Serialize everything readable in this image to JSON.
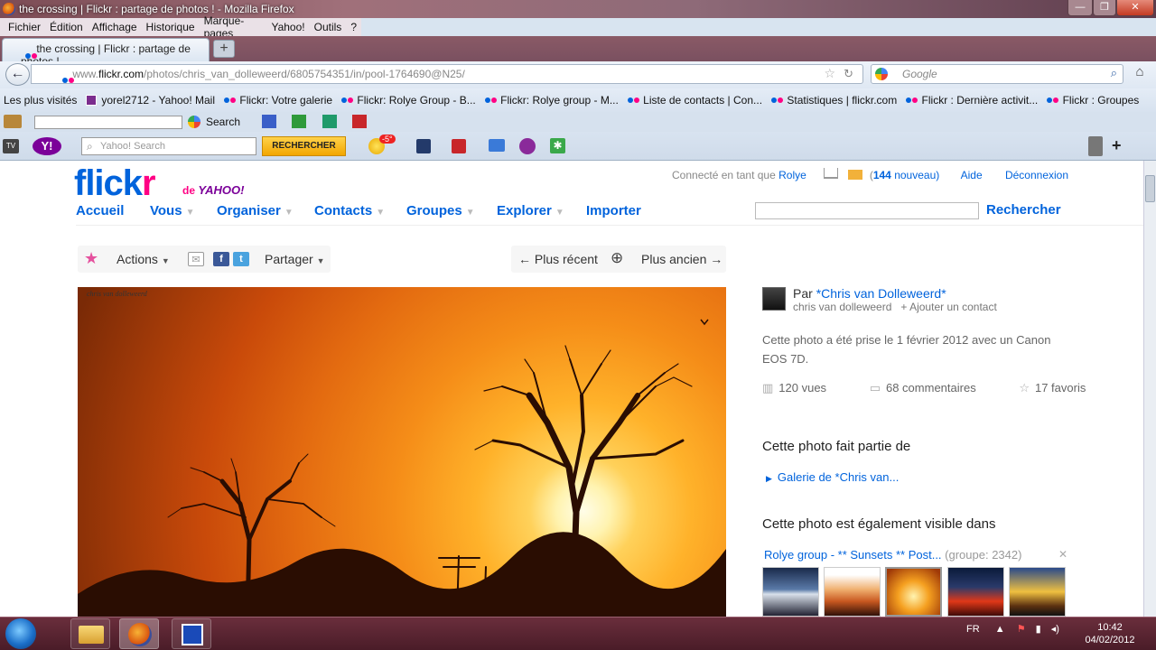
{
  "window": {
    "title": "the crossing | Flickr : partage de photos ! - Mozilla Firefox",
    "controls": [
      "—",
      "❐",
      "✕"
    ]
  },
  "menubar": [
    "Fichier",
    "Édition",
    "Affichage",
    "Historique",
    "Marque-pages",
    "Yahoo!",
    "Outils",
    "?"
  ],
  "tab": {
    "title": "the crossing | Flickr : partage de photos !",
    "new_tab": "+"
  },
  "nav": {
    "url_prefix": "www.",
    "url_domain": "flickr.com",
    "url_path": "/photos/chris_van_dolleweerd/6805754351/in/pool-1764690@N25/",
    "search_placeholder": "Google"
  },
  "bookmarks": [
    "Les plus visités",
    "yorel2712 - Yahoo! Mail",
    "Flickr: Votre galerie",
    "Flickr: Rolye Group - B...",
    "Flickr: Rolye group - M...",
    "Liste de contacts | Con...",
    "Statistiques | flickr.com",
    "Flickr : Dernière activit...",
    "Flickr : Groupes"
  ],
  "toolbar1": {
    "search_label": "Search"
  },
  "yahoo_toolbar": {
    "search_placeholder": "Yahoo! Search",
    "search_button": "RECHERCHER",
    "temp_badge": "-5°"
  },
  "flickr": {
    "logo_main": "flick",
    "logo_r": "r",
    "logo_de": "de",
    "logo_yahoo": "YAHOO!",
    "connected_prefix": "Connecté en tant que",
    "username": "Rolye",
    "mail_count": "144",
    "mail_suffix": "nouveau)",
    "mail_open": "(",
    "help": "Aide",
    "logout": "Déconnexion",
    "nav": [
      "Accueil",
      "Vous",
      "Organiser",
      "Contacts",
      "Groupes",
      "Explorer",
      "Importer"
    ],
    "search_button": "Rechercher",
    "actions": "Actions",
    "share": "Partager",
    "newer": "Plus récent",
    "older": "Plus ancien",
    "watermark": "chris van dolleweerd",
    "by": "Par",
    "owner_display": "*Chris van Dolleweerd*",
    "owner_name": "chris van dolleweerd",
    "add_contact": "+ Ajouter un contact",
    "description": "Cette photo a été prise le 1 février 2012 avec un Canon EOS 7D.",
    "views": "120 vues",
    "comments": "68 commentaires",
    "favorites": "17 favoris",
    "part_of_title": "Cette photo fait partie de",
    "gallery_link": "Galerie de *Chris van...",
    "also_visible_title": "Cette photo est également visible dans",
    "group_link": "Rolye group - ** Sunsets ** Post...",
    "group_count": "(groupe: 2342)"
  },
  "taskbar": {
    "lang": "FR",
    "time": "10:42",
    "date": "04/02/2012"
  }
}
